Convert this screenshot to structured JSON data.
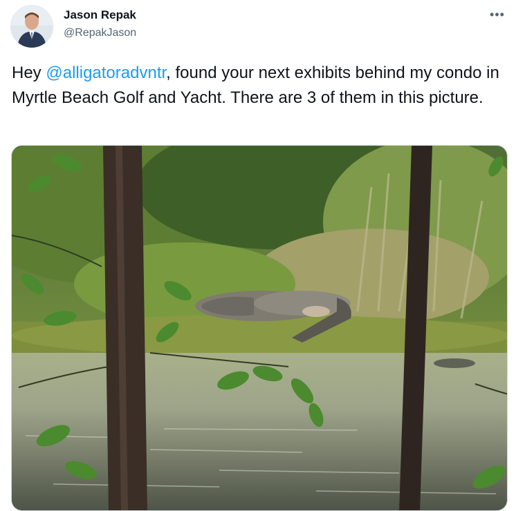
{
  "tweet": {
    "display_name": "Jason Repak",
    "handle": "@RepakJason",
    "more_icon": "more-horizontal-icon",
    "text_before": "Hey ",
    "mention": "@alligatoradvntr",
    "text_after": ", found your next exhibits behind my condo in Myrtle Beach Golf and Yacht. There are 3 of them in this picture."
  },
  "colors": {
    "mention": "#1d9bf0",
    "secondary_text": "#536471",
    "primary_text": "#0f1419"
  }
}
